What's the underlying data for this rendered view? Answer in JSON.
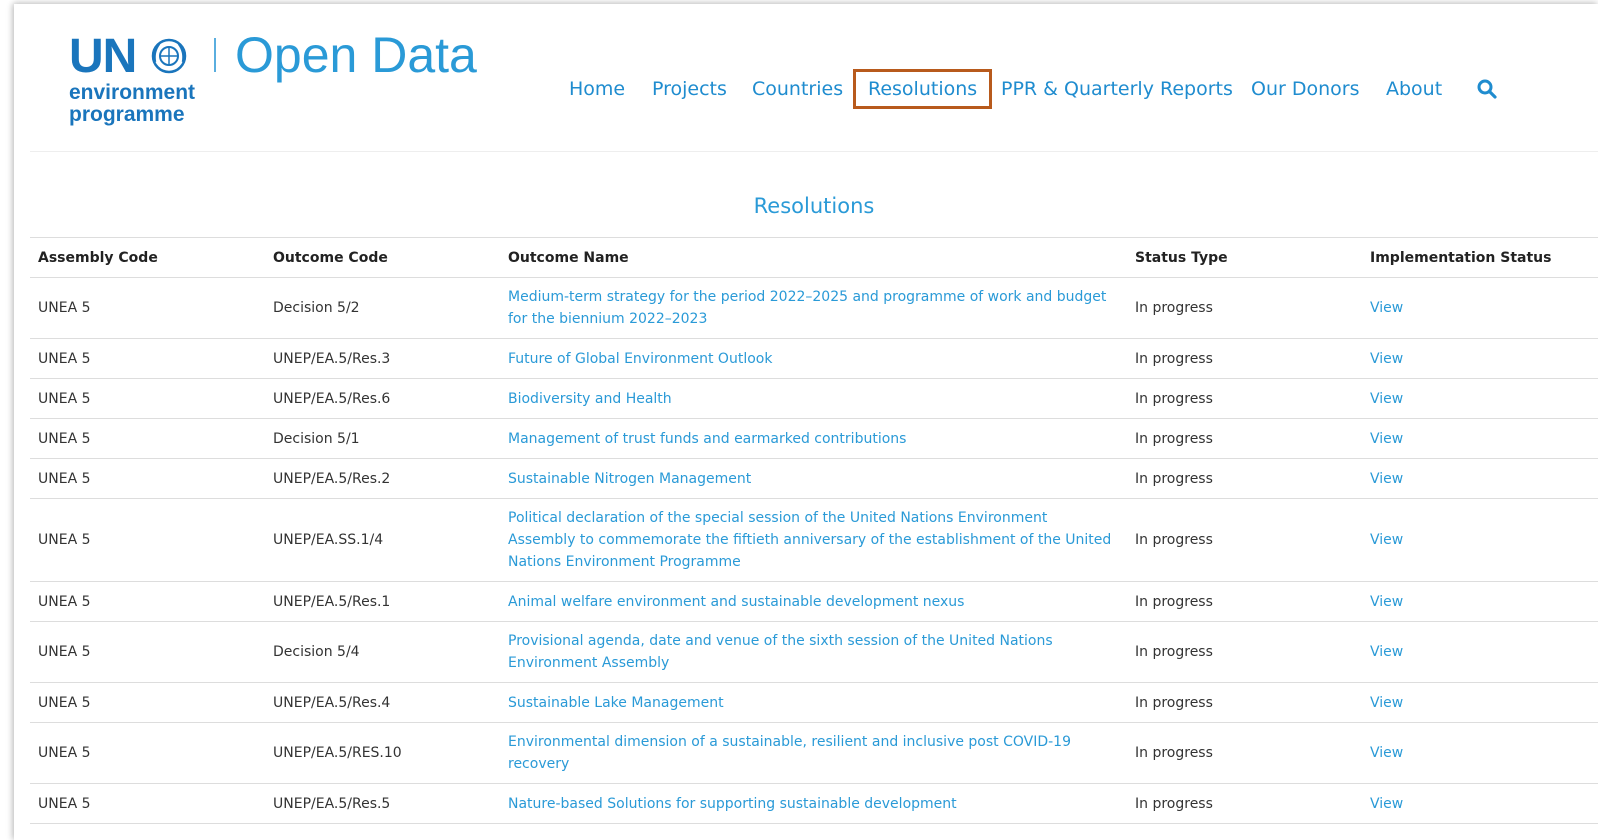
{
  "logo": {
    "un": "UN",
    "line1": "environment",
    "line2": "programme",
    "title": "Open Data"
  },
  "nav": {
    "items": [
      {
        "label": "Home"
      },
      {
        "label": "Projects"
      },
      {
        "label": "Countries"
      },
      {
        "label": "Resolutions",
        "active": true
      },
      {
        "label": "PPR & Quarterly Reports"
      },
      {
        "label": "Our Donors"
      },
      {
        "label": "About"
      }
    ],
    "search_icon": "search-icon"
  },
  "page": {
    "title": "Resolutions"
  },
  "table": {
    "headers": [
      "Assembly Code",
      "Outcome Code",
      "Outcome Name",
      "Status Type",
      "Implementation Status"
    ],
    "rows": [
      {
        "assembly": "UNEA 5",
        "code": "Decision 5/2",
        "name": "Medium-term strategy for the period 2022–2025 and programme of work and budget for the biennium 2022–2023",
        "status": "In progress",
        "impl": "View"
      },
      {
        "assembly": "UNEA 5",
        "code": "UNEP/EA.5/Res.3",
        "name": "Future of Global Environment Outlook",
        "status": "In progress",
        "impl": "View"
      },
      {
        "assembly": "UNEA 5",
        "code": "UNEP/EA.5/Res.6",
        "name": "Biodiversity and Health",
        "status": "In progress",
        "impl": "View"
      },
      {
        "assembly": "UNEA 5",
        "code": "Decision 5/1",
        "name": "Management of trust funds and earmarked contributions",
        "status": "In progress",
        "impl": "View"
      },
      {
        "assembly": "UNEA 5",
        "code": "UNEP/EA.5/Res.2",
        "name": "Sustainable Nitrogen Management",
        "status": "In progress",
        "impl": "View"
      },
      {
        "assembly": "UNEA 5",
        "code": "UNEP/EA.SS.1/4",
        "name": "Political declaration of the special session of the United Nations Environment Assembly to commemorate the fiftieth anniversary of the establishment of the United Nations Environment Programme",
        "status": "In progress",
        "impl": "View"
      },
      {
        "assembly": "UNEA 5",
        "code": "UNEP/EA.5/Res.1",
        "name": "Animal welfare environment and sustainable development nexus",
        "status": "In progress",
        "impl": "View"
      },
      {
        "assembly": "UNEA 5",
        "code": "Decision 5/4",
        "name": "Provisional agenda, date and venue of the sixth session of the United Nations Environment Assembly",
        "status": "In progress",
        "impl": "View"
      },
      {
        "assembly": "UNEA 5",
        "code": "UNEP/EA.5/Res.4",
        "name": "Sustainable Lake Management",
        "status": "In progress",
        "impl": "View"
      },
      {
        "assembly": "UNEA 5",
        "code": "UNEP/EA.5/RES.10",
        "name": "Environmental dimension of a sustainable, resilient and inclusive post COVID-19 recovery",
        "status": "In progress",
        "impl": "View"
      },
      {
        "assembly": "UNEA 5",
        "code": "UNEP/EA.5/Res.5",
        "name": "Nature-based Solutions for supporting sustainable development",
        "status": "In progress",
        "impl": "View"
      }
    ]
  },
  "colors": {
    "brand_blue": "#1a75bc",
    "link_blue": "#2a9ad7",
    "active_outline": "#b85a1c"
  }
}
